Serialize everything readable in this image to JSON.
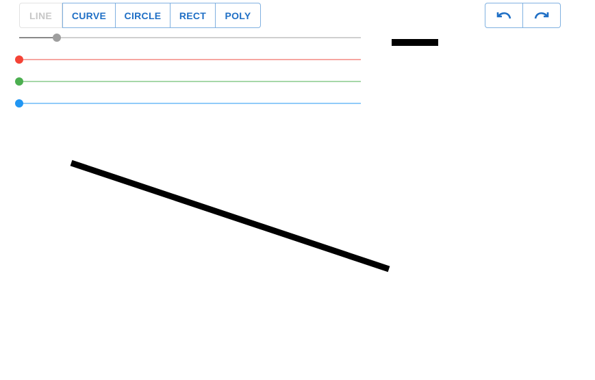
{
  "toolbar": {
    "tools": [
      {
        "label": "LINE",
        "active": true
      },
      {
        "label": "CURVE",
        "active": false
      },
      {
        "label": "CIRCLE",
        "active": false
      },
      {
        "label": "RECT",
        "active": false
      },
      {
        "label": "POLY",
        "active": false
      }
    ]
  },
  "history": {
    "undo_icon": "undo-icon",
    "redo_icon": "redo-icon"
  },
  "sliders": {
    "stroke_width": {
      "value": 0.11,
      "color": "#9e9e9e",
      "track": "#cfcfcf",
      "fill": "#888888"
    },
    "red": {
      "value": 0.0,
      "color": "#f44336",
      "track": "#f6a6a1"
    },
    "green": {
      "value": 0.0,
      "color": "#4caf50",
      "track": "#a6d7a8"
    },
    "blue": {
      "value": 0.0,
      "color": "#2196f3",
      "track": "#90cbf9"
    }
  },
  "brush": {
    "color": "#000000"
  },
  "colors": {
    "accent": "#1f6fc5",
    "border": "#7fb0e0",
    "disabled": "#c7c7c7"
  }
}
